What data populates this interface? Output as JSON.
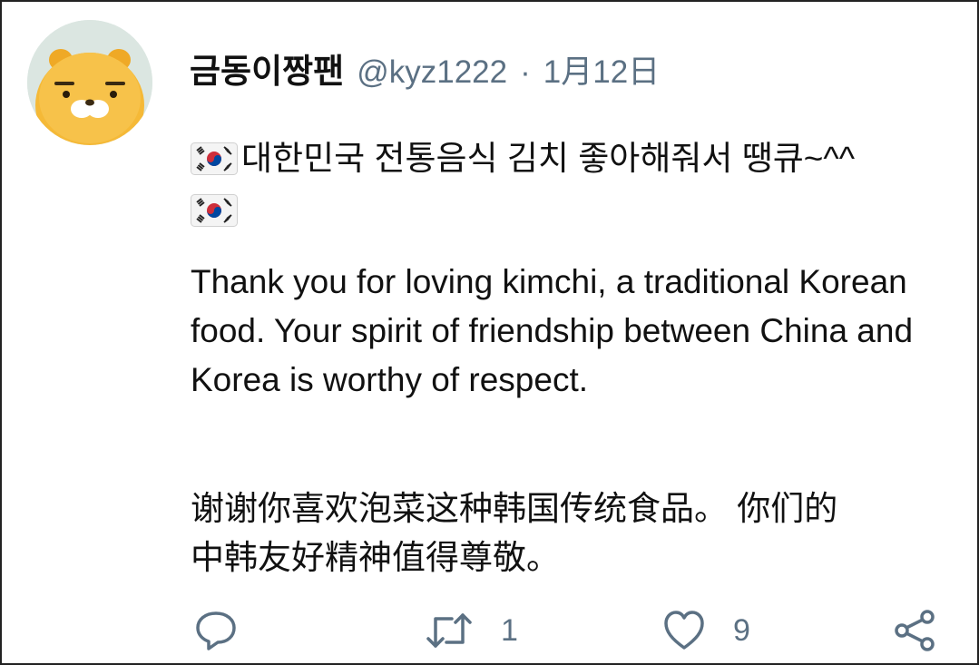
{
  "tweet": {
    "display_name": "금동이짱팬",
    "handle": "@kyz1222",
    "separator": "·",
    "date": "1月12日",
    "korean_text": "대한민국 전통음식 김치 좋아해줘서 땡큐~^^",
    "english_text": "Thank you for loving kimchi, a traditional Korean food. Your spirit of friendship between China and Korea is worthy of respect.",
    "chinese_line1": "谢谢你喜欢泡菜这种韩国传统食品。 你们的",
    "chinese_line2": "中韩友好精神值得尊敬。"
  },
  "actions": {
    "reply_count": "",
    "retweet_count": "1",
    "like_count": "9"
  },
  "icons": {
    "avatar": "kakao-ryan-avatar",
    "flag": "south-korea-flag-icon",
    "reply": "reply-icon",
    "retweet": "retweet-icon",
    "like": "heart-icon",
    "share": "share-icon"
  },
  "colors": {
    "text": "#111111",
    "muted": "#5b7083",
    "avatar_face": "#f5b937"
  }
}
